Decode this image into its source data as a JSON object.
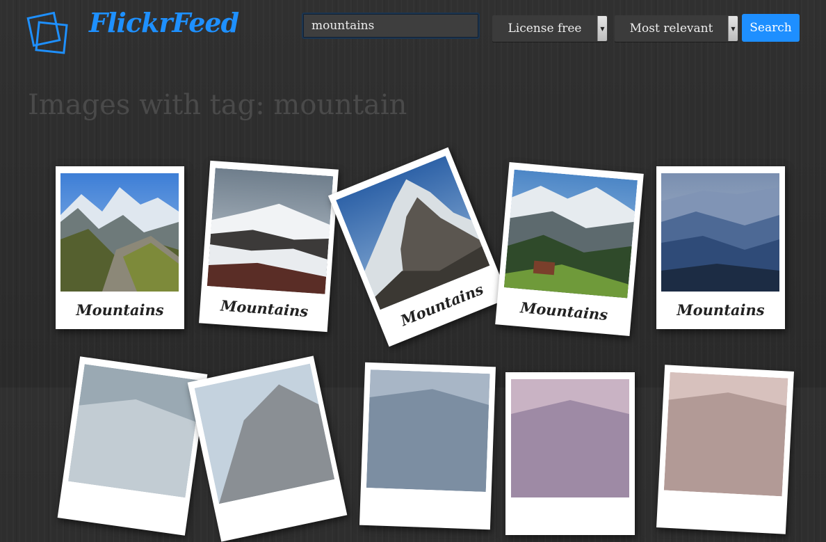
{
  "app": {
    "title": "FlickrFeed"
  },
  "search": {
    "value": "mountains"
  },
  "filters": {
    "license": {
      "selected": "License free"
    },
    "sort": {
      "selected": "Most relevant"
    }
  },
  "toolbar": {
    "search_label": "Search"
  },
  "heading": {
    "text": "Images with tag: mountain"
  },
  "photos": [
    {
      "caption": "Mountains"
    },
    {
      "caption": "Mountains"
    },
    {
      "caption": "Mountains"
    },
    {
      "caption": "Mountains"
    },
    {
      "caption": "Mountains"
    }
  ],
  "colors": {
    "accent": "#1e90ff",
    "background": "#2e2e2e",
    "card": "#ffffff"
  }
}
